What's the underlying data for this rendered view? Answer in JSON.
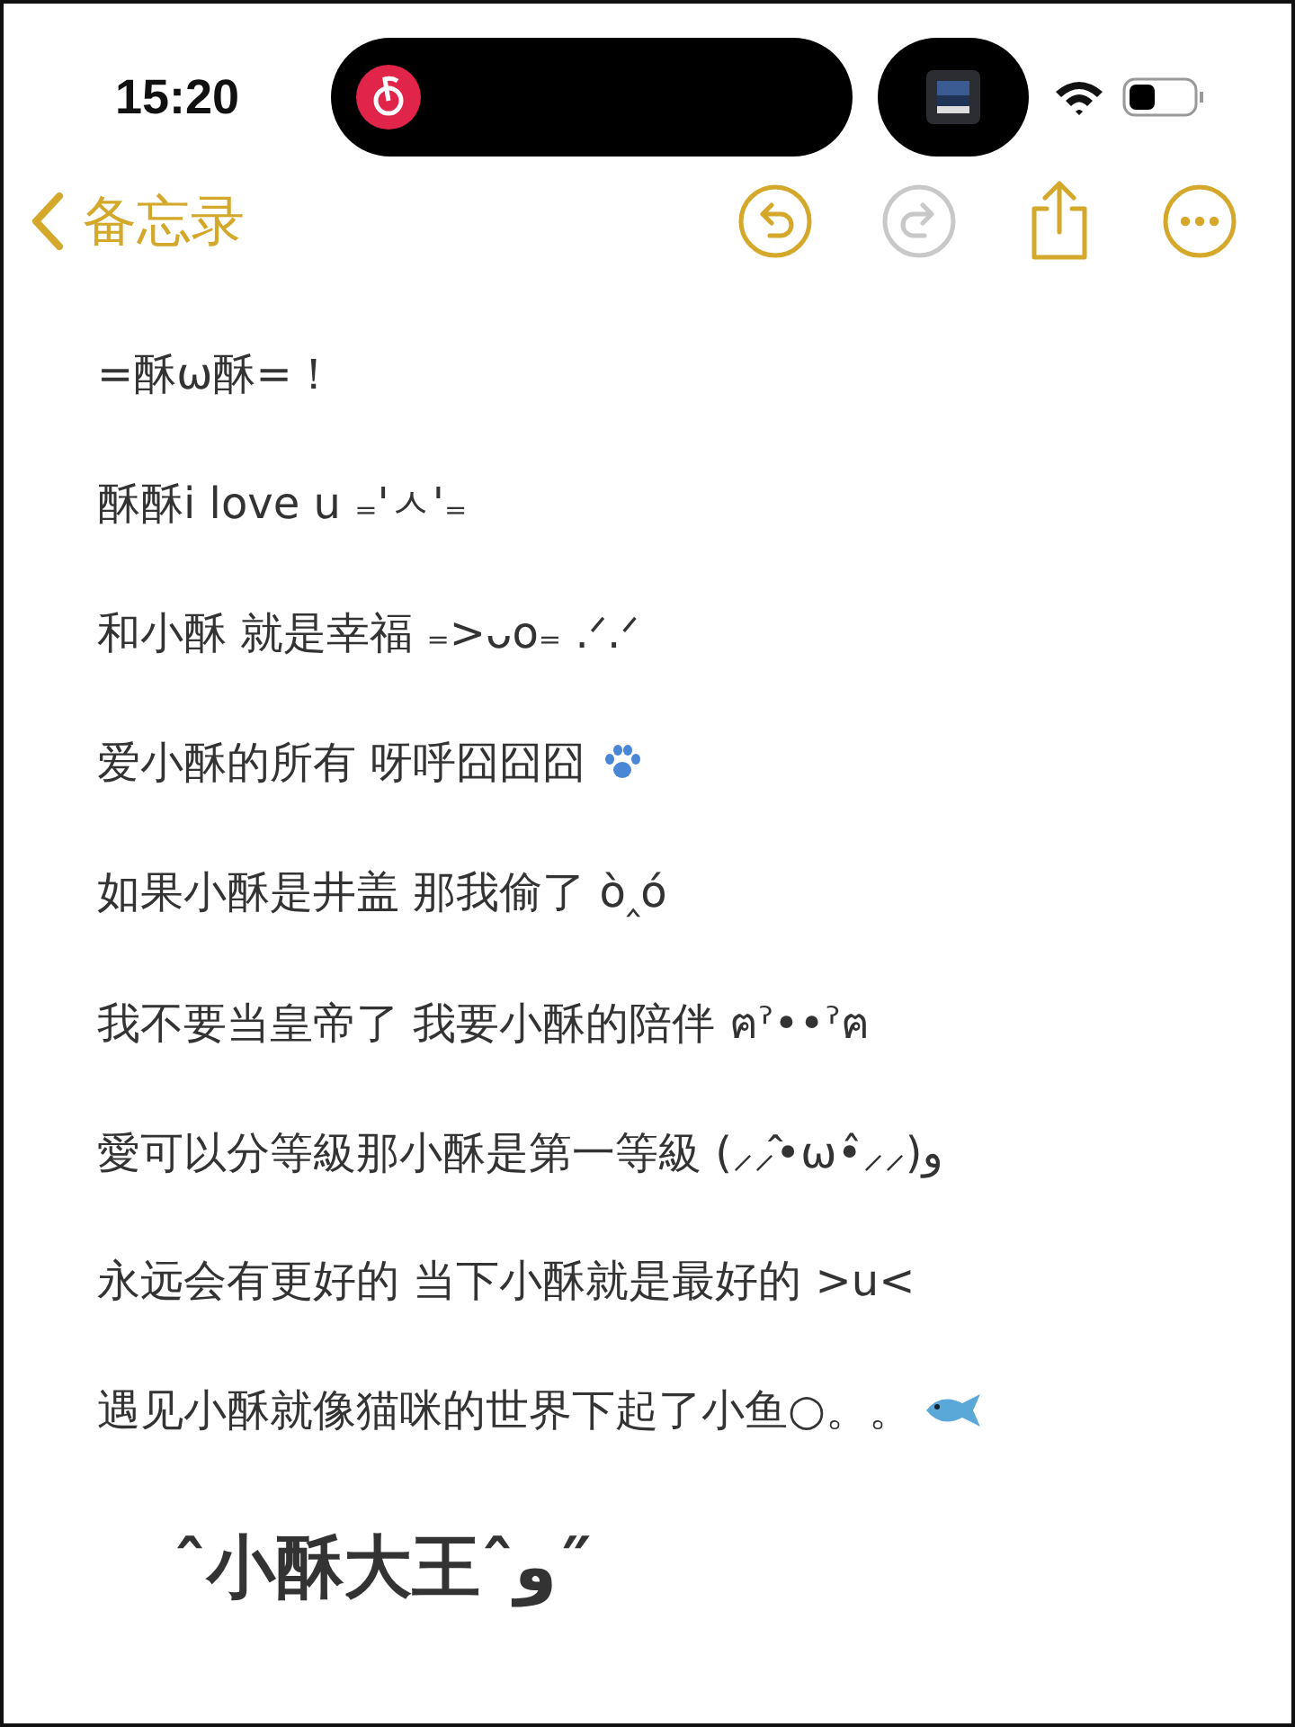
{
  "status_bar": {
    "time": "15:20"
  },
  "nav": {
    "back_label": "备忘录",
    "undo": {
      "disabled": false
    },
    "redo": {
      "disabled": true
    }
  },
  "note": {
    "lines": [
      {
        "text": "=酥ω酥=！",
        "kind": "plain"
      },
      {
        "text": "酥酥i love u ₌'ㅅ'₌",
        "kind": "plain"
      },
      {
        "text": "和小酥 就是幸福 ₌>ᴗo₌ .ᐟ.ᐟ",
        "kind": "plain"
      },
      {
        "text": "爱小酥的所有 呀呼囧囧囧",
        "kind": "paw"
      },
      {
        "text": "如果小酥是井盖 那我偷了 ò‸ó",
        "kind": "plain"
      },
      {
        "text": "我不要当皇帝了 我要小酥的陪伴 ฅˀ••ˀฅ",
        "kind": "plain"
      },
      {
        "text": "愛可以分等級那小酥是第一等級 (⸝⸝̂•ω•̂⸝⸝)و",
        "kind": "plain"
      },
      {
        "text": "永远会有更好的 当下小酥就是最好的 >u<",
        "kind": "plain"
      },
      {
        "text": "遇见小酥就像猫咪的世界下起了小鱼○。。",
        "kind": "fish"
      }
    ],
    "signature": "ˆ小酥大王ˆو˝"
  }
}
